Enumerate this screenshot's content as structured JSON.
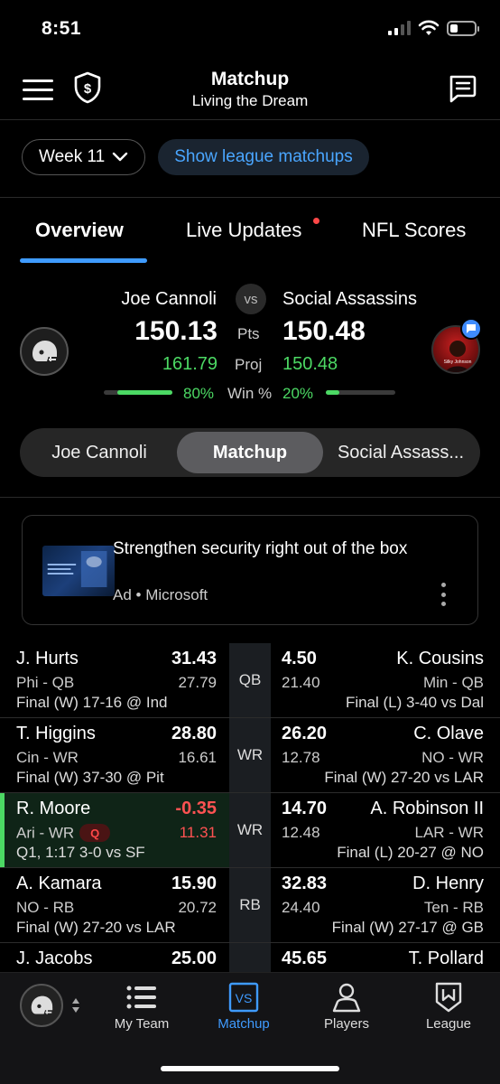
{
  "status_bar": {
    "time": "8:51"
  },
  "header": {
    "title": "Matchup",
    "subtitle": "Living the Dream"
  },
  "week_selector": {
    "label": "Week 11"
  },
  "league_matchups_button": "Show league matchups",
  "tabs": [
    {
      "label": "Overview",
      "active": true
    },
    {
      "label": "Live Updates",
      "active": false,
      "has_notification_dot": true
    },
    {
      "label": "NFL Scores",
      "active": false
    }
  ],
  "matchup": {
    "vs_label": "vs",
    "pts_label": "Pts",
    "proj_label": "Proj",
    "win_label": "Win %",
    "home": {
      "name": "Joe Cannoli",
      "points": "150.13",
      "projected": "161.79",
      "win_pct": "80%",
      "win_value": 0.8
    },
    "away": {
      "name": "Social Assassins",
      "points": "150.48",
      "projected": "150.48",
      "win_pct": "20%",
      "win_value": 0.2
    }
  },
  "segmented_control": [
    "Joe Cannoli",
    "Matchup",
    "Social Assass..."
  ],
  "segmented_active": "Matchup",
  "ad": {
    "title": "Strengthen security right out of the box",
    "source": "Ad • Microsoft"
  },
  "rows": [
    {
      "position": "QB",
      "left": {
        "name": "J. Hurts",
        "points": "31.43",
        "team_pos": "Phi - QB",
        "proj": "27.79",
        "status": "Final (W) 17-16 @ Ind"
      },
      "right": {
        "name": "K. Cousins",
        "points": "4.50",
        "team_pos": "Min - QB",
        "proj": "21.40",
        "status": "Final (L) 3-40 vs Dal"
      }
    },
    {
      "position": "WR",
      "left": {
        "name": "T. Higgins",
        "points": "28.80",
        "team_pos": "Cin - WR",
        "proj": "16.61",
        "status": "Final (W) 37-30 @ Pit"
      },
      "right": {
        "name": "C. Olave",
        "points": "26.20",
        "team_pos": "NO - WR",
        "proj": "12.78",
        "status": "Final (W) 27-20 vs LAR"
      }
    },
    {
      "position": "WR",
      "live": true,
      "left": {
        "name": "R. Moore",
        "points": "-0.35",
        "team_pos": "Ari - WR",
        "injury": "Q",
        "proj": "11.31",
        "status": "Q1, 1:17 3-0 vs SF"
      },
      "right": {
        "name": "A. Robinson II",
        "points": "14.70",
        "team_pos": "LAR - WR",
        "proj": "12.48",
        "status": "Final (L) 20-27 @ NO"
      }
    },
    {
      "position": "RB",
      "left": {
        "name": "A. Kamara",
        "points": "15.90",
        "team_pos": "NO - RB",
        "proj": "20.72",
        "status": "Final (W) 27-20 vs LAR"
      },
      "right": {
        "name": "D. Henry",
        "points": "32.83",
        "team_pos": "Ten - RB",
        "proj": "24.40",
        "status": "Final (W) 27-17 @ GB"
      }
    },
    {
      "position": "RB",
      "left": {
        "name": "J. Jacobs",
        "points": "25.00",
        "team_pos": "",
        "proj": "",
        "status": ""
      },
      "right": {
        "name": "T. Pollard",
        "points": "45.65",
        "team_pos": "",
        "proj": "",
        "status": ""
      }
    }
  ],
  "bottom_nav": [
    {
      "label": "My Team",
      "icon": "list-icon"
    },
    {
      "label": "Matchup",
      "icon": "vs-icon",
      "active": true
    },
    {
      "label": "Players",
      "icon": "player-icon"
    },
    {
      "label": "League",
      "icon": "league-shield-icon"
    }
  ],
  "colors": {
    "accent_blue": "#3f9bff",
    "win_green": "#4cd964",
    "negative_red": "#ff5252"
  }
}
